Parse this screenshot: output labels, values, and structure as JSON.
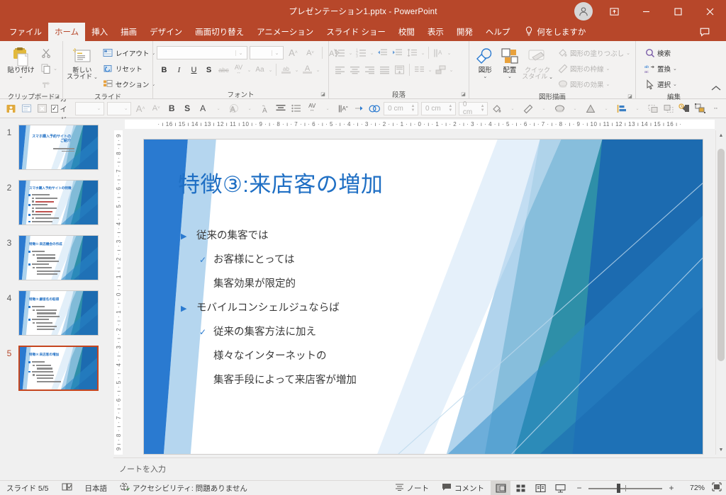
{
  "window": {
    "title": "プレゼンテーション1.pptx  -  PowerPoint",
    "accent_color": "#b7472a",
    "controls": {
      "account": "account-avatar",
      "ribbon_display": "ribbon-display-options",
      "minimize": "–",
      "maximize": "☐",
      "close": "✕"
    }
  },
  "ribbon": {
    "tabs": [
      {
        "label": "ファイル",
        "active": false
      },
      {
        "label": "ホーム",
        "active": true
      },
      {
        "label": "挿入",
        "active": false
      },
      {
        "label": "描画",
        "active": false
      },
      {
        "label": "デザイン",
        "active": false
      },
      {
        "label": "画面切り替え",
        "active": false
      },
      {
        "label": "アニメーション",
        "active": false
      },
      {
        "label": "スライド ショー",
        "active": false
      },
      {
        "label": "校閲",
        "active": false
      },
      {
        "label": "表示",
        "active": false
      },
      {
        "label": "開発",
        "active": false
      },
      {
        "label": "ヘルプ",
        "active": false
      }
    ],
    "tell_me": "何をしますか",
    "comments_button": "comment-icon",
    "collapse_ribbon": "∧",
    "groups": {
      "clipboard": {
        "label": "クリップボード",
        "paste": "貼り付け",
        "cut": "切り取り",
        "copy": "コピー",
        "format_painter": "書式のコピー/貼り付け"
      },
      "slides": {
        "label": "スライド",
        "new_slide": "新しい\nスライド",
        "new_slide_line1": "新しい",
        "new_slide_line2": "スライド",
        "layout": "レイアウト",
        "reset": "リセット",
        "section": "セクション"
      },
      "font": {
        "label": "フォント",
        "font_name_value": "",
        "font_size_value": "",
        "grow_font": "A",
        "shrink_font": "A",
        "clear_formatting": "書式のクリア",
        "bold": "B",
        "italic": "I",
        "underline": "U",
        "shadow": "S",
        "strikethrough": "abc",
        "char_spacing": "AV",
        "change_case": "Aa",
        "text_highlight": "ab",
        "font_color": "A"
      },
      "paragraph": {
        "label": "段落",
        "bullets": "箇条書き",
        "numbering": "段落番号",
        "decrease_indent": "インデントを減らす",
        "increase_indent": "インデントを増やす",
        "line_spacing": "行間",
        "text_direction": "文字列の方向",
        "align_text": "文字の配置",
        "smartart": "SmartArt グラフィックに変換",
        "align_left": "左揃え",
        "align_center": "中央揃え",
        "align_right": "右揃え",
        "justify": "両端揃え",
        "columns_btn": "段組み",
        "columns": "段の追加または削除"
      },
      "drawing": {
        "label": "図形描画",
        "shapes": "図形",
        "arrange": "配置",
        "quick_styles_line1": "クイック",
        "quick_styles_line2": "スタイル",
        "shape_fill": "図形の塗りつぶし",
        "shape_outline": "図形の枠線",
        "shape_effects": "図形の効果"
      },
      "editing": {
        "label": "編集",
        "find": "検索",
        "replace": "置換",
        "select": "選択"
      }
    }
  },
  "toolbar2": {
    "items": [
      {
        "name": "save-icon",
        "enabled": true
      },
      {
        "name": "slide-layout-icon",
        "enabled": false
      },
      {
        "name": "close-box-icon",
        "enabled": false
      }
    ],
    "guide_checkbox": {
      "label": "ガイド",
      "checked": true,
      "check_glyph": "✓"
    },
    "combo1_value": "",
    "combo2_value": "",
    "spin1_value": "0 cm",
    "spin2_value": "0 cm",
    "spin3_value": "0 cm",
    "overflow": "··",
    "buttons": [
      "grow-font-icon",
      "shrink-font-icon",
      "bold-icon",
      "shadow-icon",
      "font-color-icon",
      "text-outline-icon",
      "text-fill-icon",
      "align-center-icon",
      "bullets-icon",
      "char-spacing-icon",
      "text-direction-icon",
      "format-painter-icon",
      "shape-style-icon",
      "shape-fill-icon",
      "shape-outline-icon",
      "shape-effects-icon",
      "shape-3d-icon",
      "align-objects-icon",
      "bring-forward-icon",
      "send-backward-icon",
      "animation-icon",
      "group-icon"
    ]
  },
  "slides_pane": {
    "slides": [
      {
        "number": "1",
        "selected": false,
        "title": "スマホ購入予約サイトの\nご紹介",
        "layout": "title",
        "subtitle_lines": 2
      },
      {
        "number": "2",
        "selected": false,
        "title": "スマホ購入予約サイトの特徴",
        "layout": "content",
        "body_lines": 9
      },
      {
        "number": "3",
        "selected": false,
        "title": "特徴①:来店機会の作成",
        "layout": "content",
        "body_lines": 7
      },
      {
        "number": "4",
        "selected": false,
        "title": "特徴②:顧客名の取得",
        "layout": "content",
        "body_lines": 7
      },
      {
        "number": "5",
        "selected": true,
        "title": "特徴③:来店客の増加",
        "layout": "content",
        "body_lines": 7
      }
    ]
  },
  "rulers": {
    "horizontal": "· ı 16 ı 15 ı 14 ı 13 ı 12 ı 11 ı 10 ı · 9 · ı · 8 · ı · 7 · ı · 6 · ı · 5 · ı · 4 · ı · 3 · ı · 2 · ı · 1 · ı · 0 · ı · 1 · ı · 2 · ı · 3 · ı · 4 · ı · 5 · ı · 6 · ı · 7 · ı · 8 · ı · 9 · ı 10 ı 11 ı 12 ı 13 ı 14 ı 15 ı 16 ı ·",
    "vertical": "9 ı · 8 · ı · 7 · ı · 6 · ı · 5 · ı · 4 · ı · 3 · ı · 2 · ı · 1 · ı · 0 · ı · 1 · ı · 2 · ı · 3 · ı · 4 · ı · 5 · ı · 6 · ı · 7 · ı · 8 · ı · 9"
  },
  "slide_canvas": {
    "title": "特徴③:来店客の増加",
    "title_color": "#1f6fc4",
    "body": [
      {
        "level": 1,
        "bullet": "▶",
        "text": "従来の集客では"
      },
      {
        "level": 2,
        "bullet": "✓",
        "text": "お客様にとっては"
      },
      {
        "level": 3,
        "bullet": "",
        "text": "集客効果が限定的"
      },
      {
        "level": 1,
        "bullet": "▶",
        "text": "モバイルコンシェルジュならば"
      },
      {
        "level": 2,
        "bullet": "✓",
        "text": "従来の集客方法に加え"
      },
      {
        "level": 3,
        "bullet": "",
        "text": "様々なインターネットの"
      },
      {
        "level": 3,
        "bullet": "",
        "text": "集客手段によって来店客が増加"
      }
    ],
    "theme_colors": {
      "dark_blue": "#1c6bb0",
      "mid_blue": "#2a87c8",
      "teal": "#2e8fa8",
      "light_blue": "#9dc9e8",
      "pale_blue": "#cfe4f5"
    }
  },
  "notes": {
    "placeholder": "ノートを入力"
  },
  "status_bar": {
    "slide_counter": "スライド 5/5",
    "accessibility_icon": "accessibility-icon",
    "language": "日本語",
    "accessibility": "アクセシビリティ: 問題ありません",
    "notes_button": "ノート",
    "comments_button": "コメント",
    "views": [
      {
        "name": "normal-view",
        "active": true
      },
      {
        "name": "slide-sorter-view",
        "active": false
      },
      {
        "name": "reading-view",
        "active": false
      },
      {
        "name": "slideshow-view",
        "active": false
      }
    ],
    "zoom_out": "−",
    "zoom_in": "+",
    "zoom_level": "72%",
    "fit_to_window": "fit-slide-icon"
  }
}
